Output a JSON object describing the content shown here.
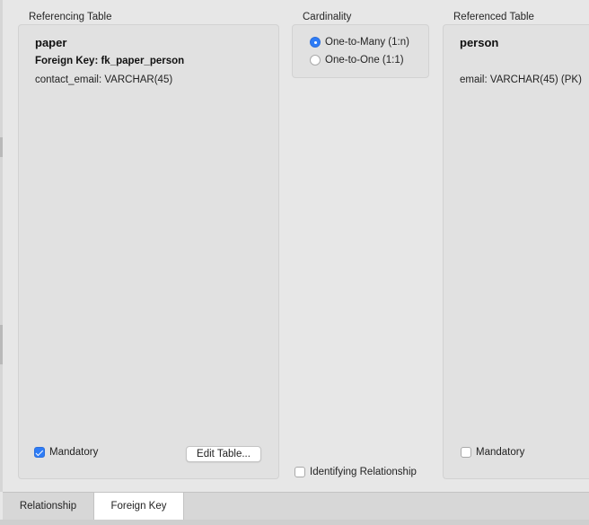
{
  "referencing": {
    "group_label": "Referencing Table",
    "table_name": "paper",
    "foreign_key": "Foreign Key: fk_paper_person",
    "columns": [
      "contact_email: VARCHAR(45)"
    ],
    "mandatory_label": "Mandatory",
    "mandatory_checked": true,
    "edit_button": "Edit Table..."
  },
  "cardinality": {
    "group_label": "Cardinality",
    "options": [
      {
        "label": "One-to-Many (1:n)",
        "selected": true
      },
      {
        "label": "One-to-One (1:1)",
        "selected": false
      }
    ],
    "identifying_label": "Identifying Relationship",
    "identifying_checked": false
  },
  "referenced": {
    "group_label": "Referenced Table",
    "table_name": "person",
    "columns": [
      "email: VARCHAR(45) (PK)"
    ],
    "mandatory_label": "Mandatory",
    "mandatory_checked": false
  },
  "tabs": [
    {
      "label": "Relationship",
      "active": false
    },
    {
      "label": "Foreign Key",
      "active": true
    }
  ],
  "colors": {
    "accent": "#2e7cf6",
    "panel": "#e1e1e1",
    "window": "#e7e7e7"
  }
}
